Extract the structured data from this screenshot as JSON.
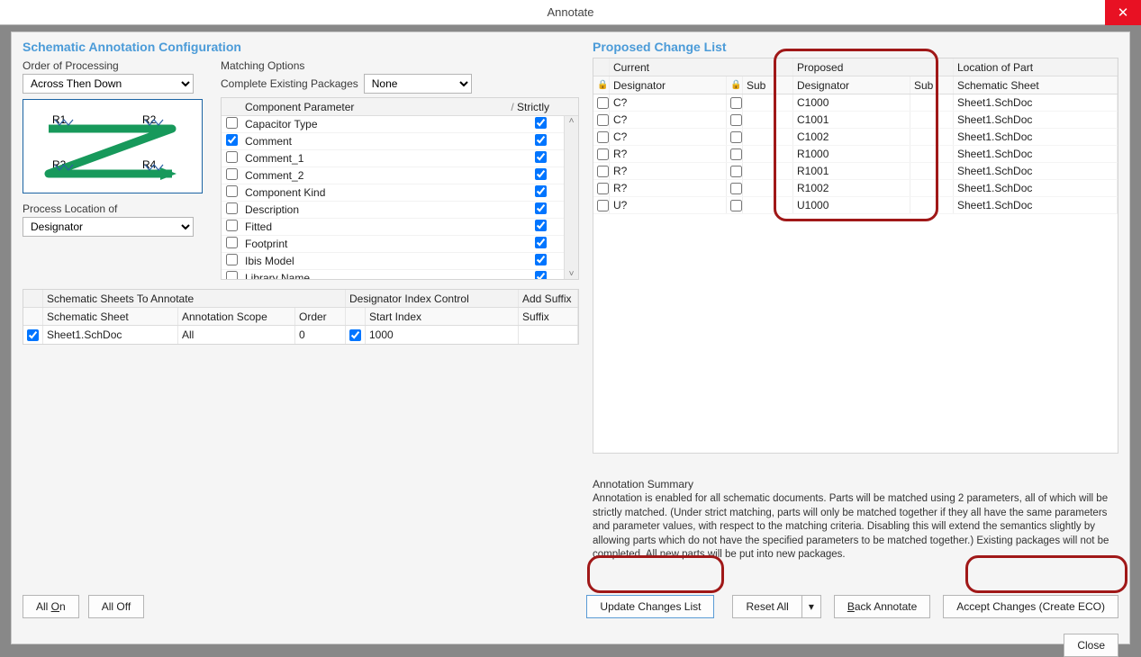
{
  "window": {
    "title": "Annotate",
    "close_icon": "✕"
  },
  "left": {
    "title": "Schematic Annotation Configuration",
    "order": {
      "label": "Order of Processing",
      "value": "Across Then Down"
    },
    "process": {
      "label": "Process Location of",
      "value": "Designator"
    },
    "matching": {
      "label": "Matching Options",
      "complete_label": "Complete Existing Packages",
      "complete_value": "None",
      "th_param": "Component Parameter",
      "th_strict": "Strictly",
      "rows": [
        {
          "checked": false,
          "name": "Capacitor Type",
          "strict": true
        },
        {
          "checked": true,
          "name": "Comment",
          "strict": true
        },
        {
          "checked": false,
          "name": "Comment_1",
          "strict": true
        },
        {
          "checked": false,
          "name": "Comment_2",
          "strict": true
        },
        {
          "checked": false,
          "name": "Component Kind",
          "strict": true
        },
        {
          "checked": false,
          "name": "Description",
          "strict": true
        },
        {
          "checked": false,
          "name": "Fitted",
          "strict": true
        },
        {
          "checked": false,
          "name": "Footprint",
          "strict": true
        },
        {
          "checked": false,
          "name": "Ibis Model",
          "strict": true
        },
        {
          "checked": false,
          "name": "Library Name",
          "strict": true
        }
      ]
    },
    "sheets": {
      "h1": "Schematic Sheets To Annotate",
      "h2": "Designator Index Control",
      "h3": "Add Suffix",
      "sub": {
        "sheet": "Schematic Sheet",
        "scope": "Annotation Scope",
        "order": "Order",
        "start": "Start Index",
        "suffix": "Suffix"
      },
      "row": {
        "checked": true,
        "sheet": "Sheet1.SchDoc",
        "scope": "All",
        "order": "0",
        "start_checked": true,
        "start": "1000",
        "suffix": ""
      }
    }
  },
  "right": {
    "title": "Proposed Change List",
    "head": {
      "current": "Current",
      "proposed": "Proposed",
      "location": "Location of Part"
    },
    "sub": {
      "designator": "Designator",
      "sub": "Sub",
      "sheet": "Schematic Sheet"
    },
    "rows": [
      {
        "cur": "C?",
        "sub": "",
        "prop": "C1000",
        "psub": "",
        "loc": "Sheet1.SchDoc"
      },
      {
        "cur": "C?",
        "sub": "",
        "prop": "C1001",
        "psub": "",
        "loc": "Sheet1.SchDoc"
      },
      {
        "cur": "C?",
        "sub": "",
        "prop": "C1002",
        "psub": "",
        "loc": "Sheet1.SchDoc"
      },
      {
        "cur": "R?",
        "sub": "",
        "prop": "R1000",
        "psub": "",
        "loc": "Sheet1.SchDoc"
      },
      {
        "cur": "R?",
        "sub": "",
        "prop": "R1001",
        "psub": "",
        "loc": "Sheet1.SchDoc"
      },
      {
        "cur": "R?",
        "sub": "",
        "prop": "R1002",
        "psub": "",
        "loc": "Sheet1.SchDoc"
      },
      {
        "cur": "U?",
        "sub": "",
        "prop": "U1000",
        "psub": "",
        "loc": "Sheet1.SchDoc"
      }
    ]
  },
  "summary": {
    "title": "Annotation Summary",
    "text": "Annotation is enabled for all schematic documents. Parts will be matched using 2 parameters, all of which will be strictly matched. (Under strict matching, parts will only be matched together if they all have the same parameters and parameter values, with respect to the matching criteria. Disabling this will extend the semantics slightly by allowing parts which do not have the specified parameters to be matched together.) Existing packages will not be completed. All new parts will be put into new packages."
  },
  "buttons": {
    "all_on": "All On",
    "all_off": "All Off",
    "update": "Update Changes List",
    "reset": "Reset All",
    "back": "Back Annotate",
    "accept": "Accept Changes (Create ECO)",
    "close": "Close"
  },
  "diagram": {
    "r1": "R1",
    "r2": "R2",
    "r3": "R3",
    "r4": "R4"
  }
}
